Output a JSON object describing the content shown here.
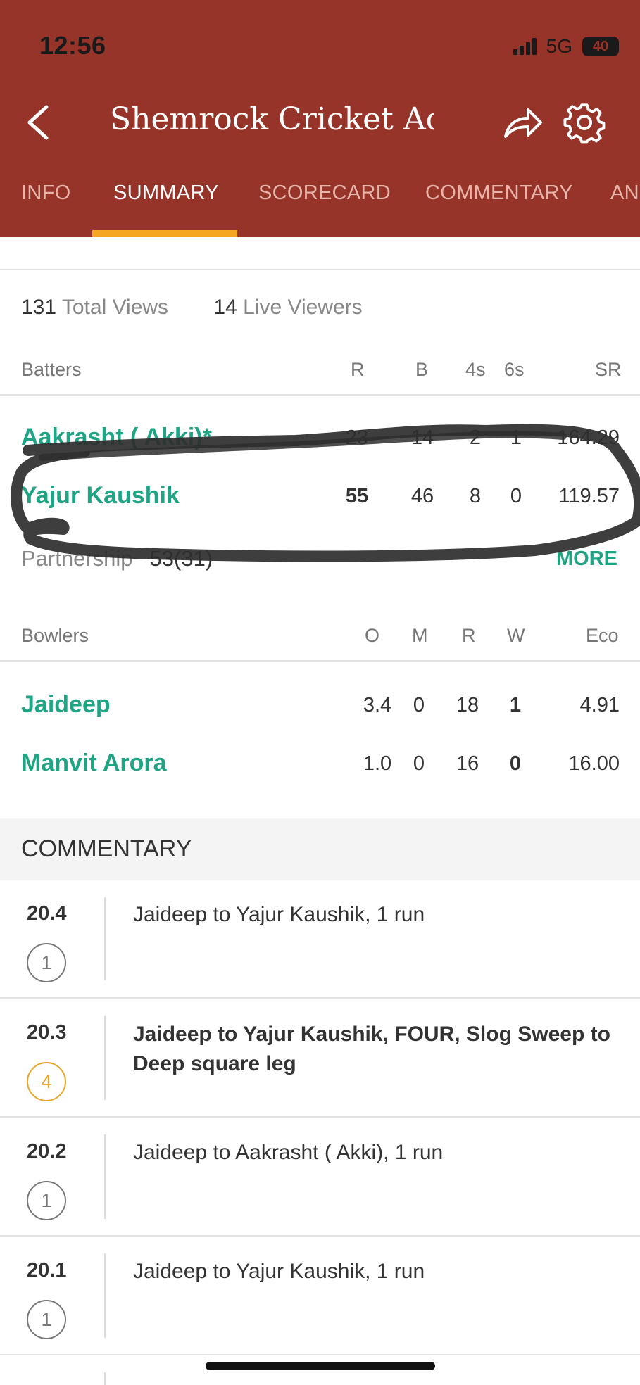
{
  "status_bar": {
    "time": "12:56",
    "network": "5G",
    "battery": "40"
  },
  "header": {
    "title": "Shemrock Cricket Aca"
  },
  "tabs": [
    {
      "label": "INFO"
    },
    {
      "label": "SUMMARY"
    },
    {
      "label": "SCORECARD"
    },
    {
      "label": "COMMENTARY"
    },
    {
      "label": "AN"
    }
  ],
  "views": {
    "total": "131",
    "total_label": "Total Views",
    "live": "14",
    "live_label": "Live Viewers"
  },
  "batters": {
    "headers": {
      "name": "Batters",
      "r": "R",
      "b": "B",
      "fours": "4s",
      "sixes": "6s",
      "sr": "SR"
    },
    "rows": [
      {
        "name": "Aakrasht ( Akki)*",
        "r": "23",
        "b": "14",
        "fours": "2",
        "sixes": "1",
        "sr": "164.29"
      },
      {
        "name": "Yajur Kaushik",
        "r": "55",
        "b": "46",
        "fours": "8",
        "sixes": "0",
        "sr": "119.57"
      }
    ],
    "partnership_label": "Partnership",
    "partnership_value": "53(31)",
    "more_label": "MORE"
  },
  "bowlers": {
    "headers": {
      "name": "Bowlers",
      "o": "O",
      "m": "M",
      "r": "R",
      "w": "W",
      "eco": "Eco"
    },
    "rows": [
      {
        "name": "Jaideep",
        "o": "3.4",
        "m": "0",
        "r": "18",
        "w": "1",
        "eco": "4.91"
      },
      {
        "name": "Manvit Arora",
        "o": "1.0",
        "m": "0",
        "r": "16",
        "w": "0",
        "eco": "16.00"
      }
    ]
  },
  "commentary": {
    "title": "COMMENTARY",
    "items": [
      {
        "over": "20.4",
        "runs": "1",
        "text": "Jaideep to Yajur Kaushik, 1 run"
      },
      {
        "over": "20.3",
        "runs": "4",
        "text": "Jaideep to Yajur Kaushik, FOUR, Slog Sweep to Deep square leg"
      },
      {
        "over": "20.2",
        "runs": "1",
        "text": "Jaideep to Aakrasht ( Akki), 1 run"
      },
      {
        "over": "20.1",
        "runs": "1",
        "text": "Jaideep to Yajur Kaushik, 1 run"
      }
    ]
  },
  "colors": {
    "header_bg": "#97342a",
    "accent_green": "#1fa484",
    "tab_indicator": "#f5a623",
    "four_ball": "#e6a62a"
  }
}
